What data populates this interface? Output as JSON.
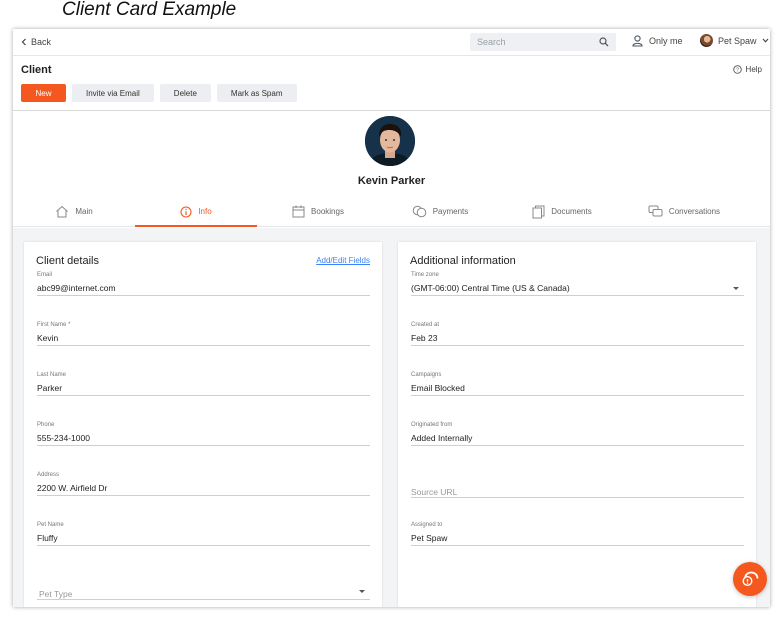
{
  "caption": "Client Card Example",
  "topbar": {
    "back_label": "Back",
    "search_placeholder": "Search",
    "owner_filter": "Only me",
    "account_name": "Pet Spaw"
  },
  "header": {
    "title": "Client",
    "help_label": "Help",
    "actions": {
      "new": "New",
      "invite": "Invite via Email",
      "delete": "Delete",
      "spam": "Mark as Spam"
    }
  },
  "profile": {
    "name": "Kevin Parker"
  },
  "tabs": [
    {
      "label": "Main",
      "icon": "home-icon"
    },
    {
      "label": "Info",
      "icon": "info-icon",
      "active": true
    },
    {
      "label": "Bookings",
      "icon": "calendar-icon"
    },
    {
      "label": "Payments",
      "icon": "coins-icon"
    },
    {
      "label": "Documents",
      "icon": "documents-icon"
    },
    {
      "label": "Conversations",
      "icon": "chat-icon"
    }
  ],
  "client_details": {
    "title": "Client details",
    "edit_link": "Add/Edit Fields",
    "fields": [
      {
        "label": "Email",
        "value": "abc99@internet.com"
      },
      {
        "label": "First Name *",
        "value": "Kevin"
      },
      {
        "label": "Last Name",
        "value": "Parker"
      },
      {
        "label": "Phone",
        "value": "555-234-1000"
      },
      {
        "label": "Address",
        "value": "2200 W. Airfield Dr"
      },
      {
        "label": "Pet Name",
        "value": "Fluffy"
      }
    ],
    "pet_type_placeholder": "Pet Type"
  },
  "additional_info": {
    "title": "Additional information",
    "fields": [
      {
        "label": "Time zone",
        "value": "(GMT-06:00) Central Time (US & Canada)"
      },
      {
        "label": "Created at",
        "value": "Feb 23"
      },
      {
        "label": "Campaigns",
        "value": "Email Blocked"
      },
      {
        "label": "Originated from",
        "value": "Added Internally"
      }
    ],
    "source_url_placeholder": "Source URL",
    "assigned": {
      "label": "Assigned to",
      "value": "Pet Spaw"
    }
  },
  "colors": {
    "accent": "#f4581f",
    "link": "#3b82f6",
    "button_bg": "#eceef1",
    "content_bg": "#f3f4f6"
  }
}
